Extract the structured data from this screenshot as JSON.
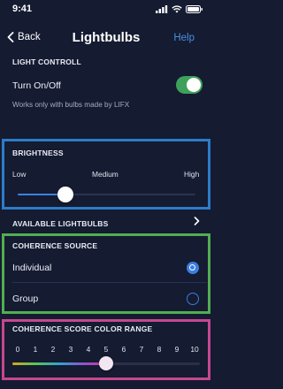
{
  "status_bar": {
    "time": "9:41",
    "icons": [
      "signal-icon",
      "wifi-icon",
      "battery-icon"
    ]
  },
  "nav": {
    "back_label": "Back",
    "title": "Lightbulbs",
    "help_label": "Help"
  },
  "light_control": {
    "header": "LIGHT CONTROLL",
    "toggle_label": "Turn On/Off",
    "toggle_on": true,
    "note": "Works only with bulbs made by LIFX"
  },
  "brightness": {
    "header": "BRIGHTNESS",
    "labels": [
      "Low",
      "Medium",
      "High"
    ],
    "value_fraction": 0.25
  },
  "available_lightbulbs": {
    "label": "AVAILABLE LIGHTBULBS"
  },
  "coherence_source": {
    "header": "COHERENCE SOURCE",
    "options": [
      {
        "label": "Individual",
        "selected": true
      },
      {
        "label": "Group",
        "selected": false
      }
    ]
  },
  "color_range": {
    "header": "COHERENCE SCORE COLOR RANGE",
    "ticks": [
      "0",
      "1",
      "2",
      "3",
      "4",
      "5",
      "6",
      "7",
      "8",
      "9",
      "10"
    ],
    "value": 5
  },
  "colors": {
    "background": "#151b31",
    "accent_blue": "#3a7ee0",
    "toggle_green": "#3fa05c",
    "brightness_border": "#2c7cc8",
    "coherence_border": "#52ae52",
    "color_range_border": "#c74690"
  }
}
